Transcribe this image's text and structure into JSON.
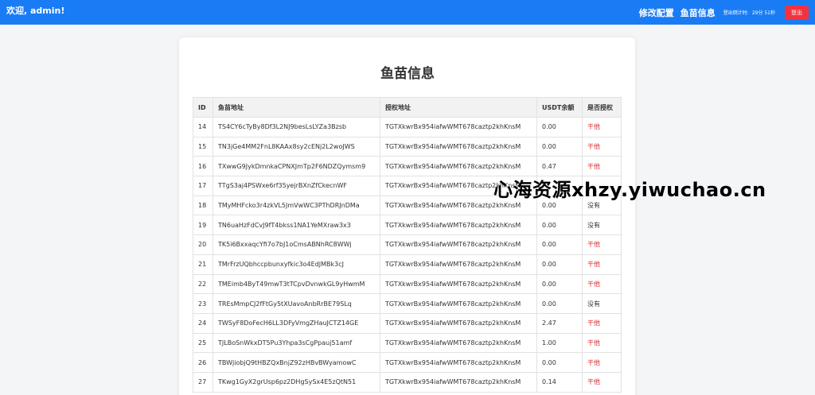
{
  "header": {
    "welcome": "欢迎, admin!",
    "nav_edit_config": "修改配置",
    "nav_fish_info": "鱼苗信息",
    "time_label": "登出倒计时:",
    "time_value": "29分 51秒",
    "logout": "登出",
    "colors": {
      "bar": "#1a7cf5",
      "logout": "#f2333e"
    }
  },
  "main": {
    "title": "鱼苗信息",
    "table": {
      "headers": [
        "ID",
        "鱼苗地址",
        "授权地址",
        "USDT余额",
        "是否授权"
      ],
      "rows": [
        {
          "id": "14",
          "fish": "TS4CY6cTyBy8Df3L2NJ9besLsLYZa3Bzsb",
          "auth": "TGTXkwrBx954iafwWMT678caztp2khKnsM",
          "usdt": "0.00",
          "authorized": "干他",
          "status": "yes"
        },
        {
          "id": "15",
          "fish": "TN3jGe4MM2FnL8KAAx8sy2cENj2L2woJWS",
          "auth": "TGTXkwrBx954iafwWMT678caztp2khKnsM",
          "usdt": "0.00",
          "authorized": "干他",
          "status": "yes"
        },
        {
          "id": "16",
          "fish": "TXwwG9JykDmnkaCPNXJmTp2F6NDZQymsm9",
          "auth": "TGTXkwrBx954iafwWMT678caztp2khKnsM",
          "usdt": "0.47",
          "authorized": "干他",
          "status": "yes"
        },
        {
          "id": "17",
          "fish": "TTgS3aj4PSWxe6rf35yejrBXnZfCkecnWF",
          "auth": "TGTXkwrBx954iafwWMT678caztp2khKnsM",
          "usdt": "",
          "authorized": "",
          "status": "yes"
        },
        {
          "id": "18",
          "fish": "TMyMHFcko3r4zkVL5JmVwWC3PThDRJnDMa",
          "auth": "TGTXkwrBx954iafwWMT678caztp2khKnsM",
          "usdt": "0.00",
          "authorized": "没有",
          "status": "no"
        },
        {
          "id": "19",
          "fish": "TN6uaHzFdCvJ9fT4bkss1NA1YeMXraw3x3",
          "auth": "TGTXkwrBx954iafwWMT678caztp2khKnsM",
          "usdt": "0.00",
          "authorized": "没有",
          "status": "no"
        },
        {
          "id": "20",
          "fish": "TK5i6BxxaqcYfi7o7bJ1oCmsABNhRC8WWj",
          "auth": "TGTXkwrBx954iafwWMT678caztp2khKnsM",
          "usdt": "0.00",
          "authorized": "干他",
          "status": "yes"
        },
        {
          "id": "21",
          "fish": "TMrFrzUQbhccpbunxyfkic3o4EdJMBk3cJ",
          "auth": "TGTXkwrBx954iafwWMT678caztp2khKnsM",
          "usdt": "0.00",
          "authorized": "干他",
          "status": "yes"
        },
        {
          "id": "22",
          "fish": "TMEimb4ByT49mwT3tTCpvDvnwkGL9yHwmM",
          "auth": "TGTXkwrBx954iafwWMT678caztp2khKnsM",
          "usdt": "0.00",
          "authorized": "干他",
          "status": "yes"
        },
        {
          "id": "23",
          "fish": "TREsMmpCJ2fFtGy5tXUavoAnbRrBE79SLq",
          "auth": "TGTXkwrBx954iafwWMT678caztp2khKnsM",
          "usdt": "0.00",
          "authorized": "没有",
          "status": "no"
        },
        {
          "id": "24",
          "fish": "TWSyF8DoFecH6LL3DFyVmgZHauJCTZ14GE",
          "auth": "TGTXkwrBx954iafwWMT678caztp2khKnsM",
          "usdt": "2.47",
          "authorized": "干他",
          "status": "yes"
        },
        {
          "id": "25",
          "fish": "TJLBoSnWkxDT5Pu3Yhpa3sCgPpauj51amf",
          "auth": "TGTXkwrBx954iafwWMT678caztp2khKnsM",
          "usdt": "1.00",
          "authorized": "干他",
          "status": "yes"
        },
        {
          "id": "26",
          "fish": "TBWjiobjQ9tHBZQxBnjZ92zHBvBWyamowC",
          "auth": "TGTXkwrBx954iafwWMT678caztp2khKnsM",
          "usdt": "0.00",
          "authorized": "干他",
          "status": "yes"
        },
        {
          "id": "27",
          "fish": "TKwg1GyX2grUsp6pz2DHgSySx4E5zQtN51",
          "auth": "TGTXkwrBx954iafwWMT678caztp2khKnsM",
          "usdt": "0.14",
          "authorized": "干他",
          "status": "yes"
        }
      ]
    }
  },
  "watermark": "心海资源xhzy.yiwuchao.cn",
  "colors": {
    "yes": "#d7262b",
    "no": "#333333"
  }
}
